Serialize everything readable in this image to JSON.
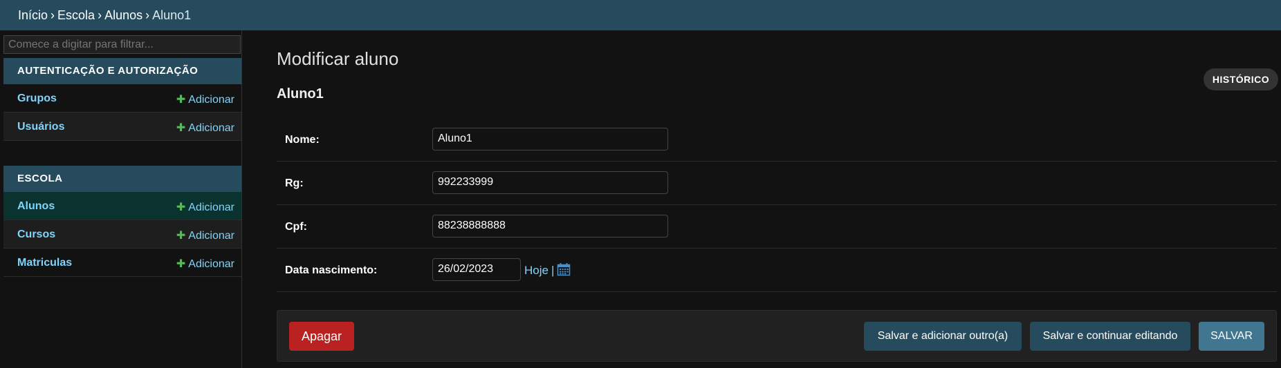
{
  "breadcrumb": {
    "items": [
      "Início",
      "Escola",
      "Alunos"
    ],
    "separator": "›",
    "current": "Aluno1"
  },
  "sidebar": {
    "filter_placeholder": "Comece a digitar para filtrar...",
    "modules": [
      {
        "caption": "AUTENTICAÇÃO E AUTORIZAÇÃO",
        "models": [
          {
            "name": "Grupos",
            "add_label": "Adicionar"
          },
          {
            "name": "Usuários",
            "add_label": "Adicionar"
          }
        ]
      },
      {
        "caption": "ESCOLA",
        "models": [
          {
            "name": "Alunos",
            "add_label": "Adicionar",
            "selected": true
          },
          {
            "name": "Cursos",
            "add_label": "Adicionar"
          },
          {
            "name": "Matriculas",
            "add_label": "Adicionar"
          }
        ]
      }
    ]
  },
  "main": {
    "title": "Modificar aluno",
    "history_label": "HISTÓRICO",
    "object_name": "Aluno1",
    "fields": [
      {
        "label": "Nome:",
        "value": "Aluno1"
      },
      {
        "label": "Rg:",
        "value": "992233999"
      },
      {
        "label": "Cpf:",
        "value": "88238888888"
      },
      {
        "label": "Data nascimento:",
        "value": "26/02/2023",
        "today_label": "Hoje",
        "divider": "|"
      }
    ],
    "actions": {
      "delete_label": "Apagar",
      "save_add_label": "Salvar e adicionar outro(a)",
      "save_continue_label": "Salvar e continuar editando",
      "save_label": "SALVAR"
    }
  },
  "colors": {
    "header_bg": "#264b5d",
    "link": "#81d4fa",
    "add_plus": "#5bb75b",
    "delete_button": "#ba2121",
    "save_button": "#417690"
  },
  "icons": {
    "add": "plus-icon",
    "calendar": "calendar-icon"
  }
}
